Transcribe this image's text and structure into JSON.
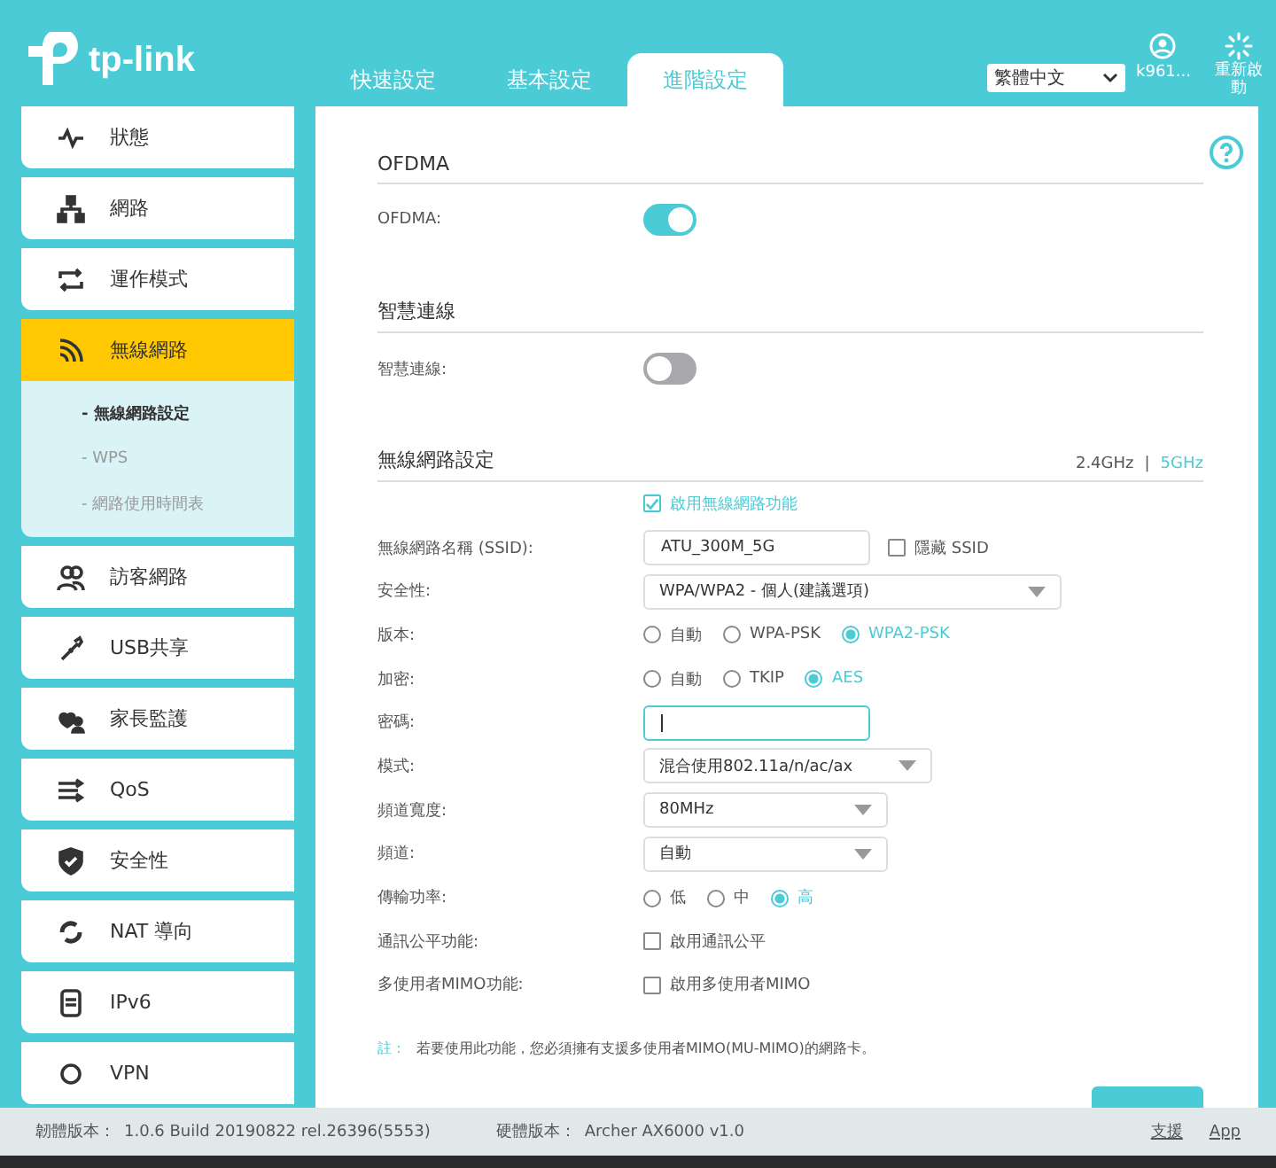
{
  "header": {
    "logo": "tp-link",
    "tabs": [
      {
        "label": "快速設定",
        "selected": false
      },
      {
        "label": "基本設定",
        "selected": false
      },
      {
        "label": "進階設定",
        "selected": true
      }
    ],
    "language": {
      "value": "繁體中文"
    },
    "user": "k961...",
    "reboot": "重新啟動"
  },
  "sidebar": {
    "items": [
      {
        "label": "狀態",
        "selected": false
      },
      {
        "label": "網路",
        "selected": false
      },
      {
        "label": "運作模式",
        "selected": false
      },
      {
        "label": "無線網路",
        "selected": true,
        "expanded": true,
        "children": [
          {
            "label": "- 無線網路設定",
            "selected": true
          },
          {
            "label": "- WPS",
            "selected": false
          },
          {
            "label": "- 網路使用時間表",
            "selected": false
          }
        ]
      },
      {
        "label": "訪客網路",
        "selected": false
      },
      {
        "label": "USB共享",
        "selected": false
      },
      {
        "label": "家長監護",
        "selected": false
      },
      {
        "label": "QoS",
        "selected": false
      },
      {
        "label": "安全性",
        "selected": false
      },
      {
        "label": "NAT 導向",
        "selected": false
      },
      {
        "label": "IPv6",
        "selected": false
      },
      {
        "label": "VPN",
        "selected": false
      }
    ]
  },
  "content": {
    "ofdma": {
      "title": "OFDMA",
      "label": "OFDMA:",
      "on": true
    },
    "smart_connect": {
      "title": "智慧連線",
      "label": "智慧連線:",
      "on": false
    },
    "wireless": {
      "title": "無線網路設定",
      "band_separator": "|",
      "bands": [
        {
          "label": "2.4GHz",
          "selected": false
        },
        {
          "label": "5GHz",
          "selected": true
        }
      ],
      "enable": {
        "label": "啟用無線網路功能",
        "checked": true
      },
      "fields": [
        {
          "kind": "text",
          "label": "無線網路名稱 (SSID):",
          "value": "ATU_300M_5G",
          "focused": false,
          "extra": {
            "label": "隱藏 SSID",
            "checked": false
          }
        },
        {
          "kind": "select",
          "label": "安全性:",
          "value": "WPA/WPA2 - 個人(建議選項)"
        },
        {
          "kind": "radio",
          "label": "版本:",
          "options": [
            {
              "label": "自動",
              "selected": false
            },
            {
              "label": "WPA-PSK",
              "selected": false
            },
            {
              "label": "WPA2-PSK",
              "selected": true
            }
          ]
        },
        {
          "kind": "radio",
          "label": "加密:",
          "options": [
            {
              "label": "自動",
              "selected": false
            },
            {
              "label": "TKIP",
              "selected": false
            },
            {
              "label": "AES",
              "selected": true
            }
          ]
        },
        {
          "kind": "text",
          "label": "密碼:",
          "focused": true
        },
        {
          "kind": "select",
          "label": "模式:",
          "value": "混合使用802.11a/n/ac/ax"
        },
        {
          "kind": "select",
          "label": "頻道寬度:",
          "value": "80MHz"
        },
        {
          "kind": "select",
          "label": "頻道:",
          "value": "自動"
        },
        {
          "kind": "radio",
          "label": "傳輸功率:",
          "options": [
            {
              "label": "低",
              "selected": false
            },
            {
              "label": "中",
              "selected": false
            },
            {
              "label": "高",
              "selected": true
            }
          ]
        },
        {
          "kind": "checkbox",
          "label": "通訊公平功能:",
          "option": {
            "label": "啟用通訊公平",
            "checked": false
          }
        },
        {
          "kind": "checkbox",
          "label": "多使用者MIMO功能:",
          "option": {
            "label": "啟用多使用者MIMO",
            "checked": false
          }
        }
      ]
    },
    "note": {
      "label": "註：",
      "text": "若要使用此功能，您必須擁有支援多使用者MIMO(MU-MIMO)的網路卡。"
    }
  },
  "footer": {
    "firmware_label": "韌體版本：",
    "firmware": "1.0.6 Build 20190822 rel.26396(5553)",
    "hardware_label": "硬體版本：",
    "hardware": "Archer AX6000 v1.0",
    "links": [
      "支援",
      "App"
    ]
  }
}
